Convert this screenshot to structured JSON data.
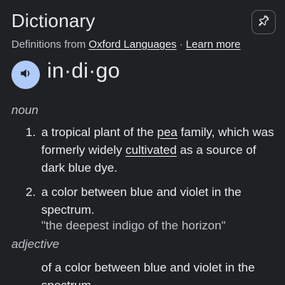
{
  "header": {
    "title": "Dictionary",
    "pin_icon": "pin-icon"
  },
  "source": {
    "prefix": "Definitions from ",
    "provider_link": "Oxford Languages",
    "separator": "·",
    "learn_more": "Learn more"
  },
  "entry": {
    "speak_icon": "speaker-icon",
    "headword": "in·di·go"
  },
  "noun": {
    "label": "noun",
    "definitions": [
      {
        "number": "1.",
        "part1": "a tropical plant of the ",
        "link1": "pea",
        "part2": " family, which was formerly widely ",
        "link2": "cultivated",
        "part3": " as a source of dark blue dye."
      },
      {
        "number": "2.",
        "text": "a color between blue and violet in the spectrum.",
        "example": "\"the deepest indigo of the horizon\""
      }
    ]
  },
  "adjective": {
    "label": "adjective",
    "definition": "of a color between blue and violet in the spectrum."
  },
  "colors": {
    "background": "#202124",
    "text": "#e8eaed",
    "muted": "#bdc1c6",
    "speak_button": "#aecbfa"
  }
}
